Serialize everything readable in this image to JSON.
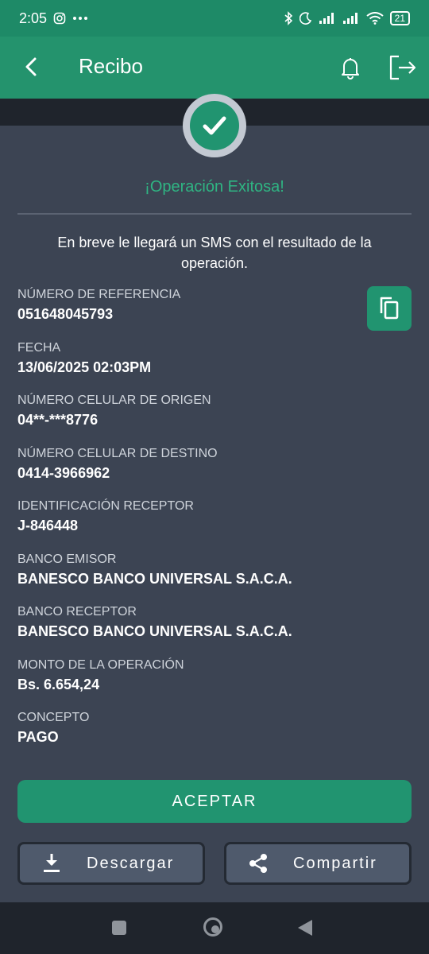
{
  "status_bar": {
    "time": "2:05",
    "battery": "21",
    "left_icons": [
      "instagram-icon",
      "more-dots-icon"
    ],
    "right_icons": [
      "bluetooth-icon",
      "do-not-disturb-icon",
      "signal-icon",
      "signal-icon",
      "wifi-icon",
      "battery-icon"
    ]
  },
  "header": {
    "title": "Recibo",
    "icons": [
      "back-arrow-icon",
      "bell-icon",
      "logout-icon"
    ]
  },
  "status": {
    "success_text": "¡Operación Exitosa!",
    "sms_message": "En breve le llegará un SMS con el resultado de la operación."
  },
  "details": [
    {
      "label": "NÚMERO DE REFERENCIA",
      "value": "051648045793"
    },
    {
      "label": "FECHA",
      "value": "13/06/2025 02:03PM"
    },
    {
      "label": "NÚMERO CELULAR DE ORIGEN",
      "value": "04**-***8776"
    },
    {
      "label": "NÚMERO CELULAR DE DESTINO",
      "value": "0414-3966962"
    },
    {
      "label": "IDENTIFICACIÓN RECEPTOR",
      "value": "J-846448"
    },
    {
      "label": "BANCO EMISOR",
      "value": "BANESCO BANCO UNIVERSAL S.A.C.A."
    },
    {
      "label": "BANCO RECEPTOR",
      "value": "BANESCO BANCO UNIVERSAL S.A.C.A."
    },
    {
      "label": "MONTO DE LA OPERACIÓN",
      "value": "Bs. 6.654,24"
    },
    {
      "label": "CONCEPTO",
      "value": "PAGO"
    }
  ],
  "actions": {
    "accept": "ACEPTAR",
    "download": "Descargar",
    "share": "Compartir"
  },
  "colors": {
    "accent_green": "#219470",
    "header_green": "#24936d",
    "success_text": "#2fb583",
    "background": "#3c4453"
  }
}
